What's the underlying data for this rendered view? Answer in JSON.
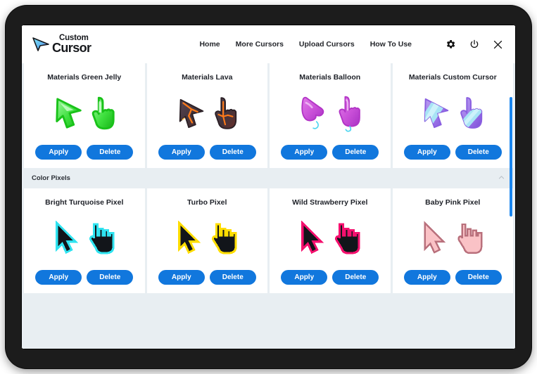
{
  "app": {
    "logo": {
      "icon": "cursor-arrow-logo-icon",
      "word_top": "Custom",
      "word_bottom": "Cursor"
    },
    "nav_links": [
      {
        "label": "Home",
        "name": "nav-home"
      },
      {
        "label": "More Cursors",
        "name": "nav-more-cursors"
      },
      {
        "label": "Upload Cursors",
        "name": "nav-upload-cursors"
      },
      {
        "label": "How To Use",
        "name": "nav-how-to-use"
      }
    ],
    "actions": [
      {
        "name": "settings-gear-icon"
      },
      {
        "name": "power-toggle-icon"
      },
      {
        "name": "close-window-icon"
      }
    ]
  },
  "buttons": {
    "apply_label": "Apply",
    "delete_label": "Delete"
  },
  "sections": [
    {
      "name": "materials-section",
      "header": null,
      "cards": [
        {
          "title": "Materials Green Jelly",
          "style": "jelly-green"
        },
        {
          "title": "Materials Lava",
          "style": "lava"
        },
        {
          "title": "Materials Balloon",
          "style": "balloon"
        },
        {
          "title": "Materials Custom Cursor",
          "style": "custom-purple"
        }
      ]
    },
    {
      "name": "color-pixels-section",
      "header": {
        "title": "Color Pixels",
        "chevron": "chevron-up-icon"
      },
      "cards": [
        {
          "title": "Bright Turquoise Pixel",
          "style": "pixel-turquoise"
        },
        {
          "title": "Turbo Pixel",
          "style": "pixel-yellow"
        },
        {
          "title": "Wild Strawberry Pixel",
          "style": "pixel-strawberry"
        },
        {
          "title": "Baby Pink Pixel",
          "style": "pixel-babypink"
        }
      ]
    }
  ],
  "colors": {
    "accent_blue": "#1177dd",
    "scrollbar_blue": "#1a86f0",
    "content_bg": "#e8eef2",
    "card_bg": "#ffffff",
    "frame_dark": "#1c1c1c"
  }
}
